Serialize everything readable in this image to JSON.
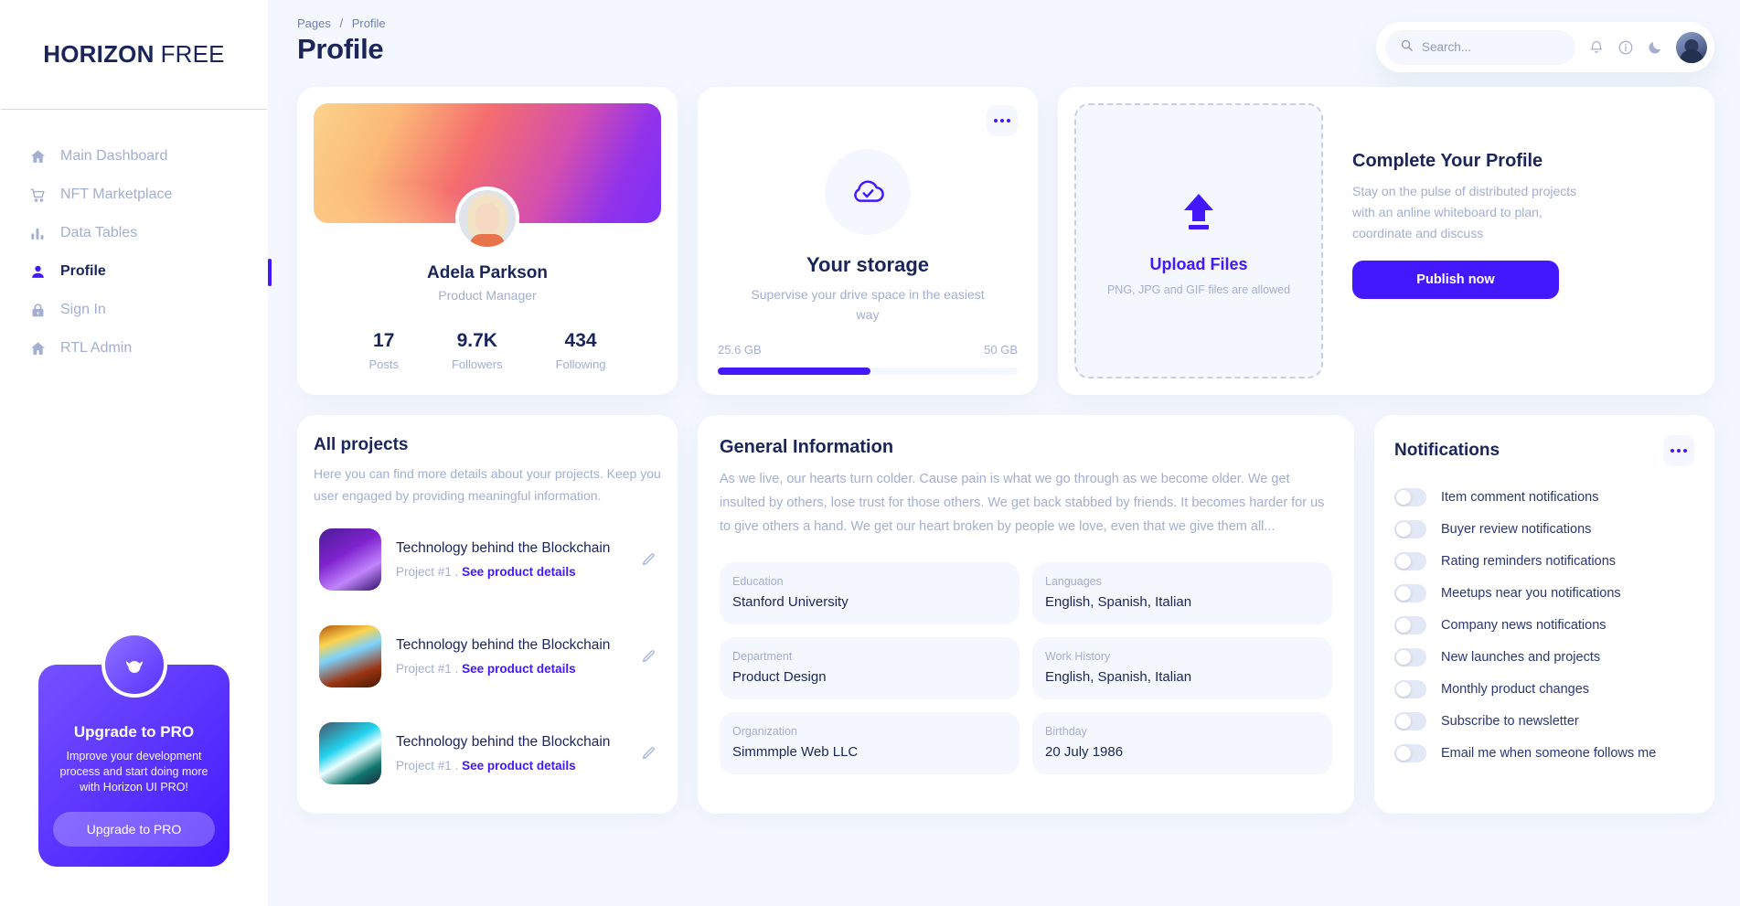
{
  "brand": {
    "bold": "HORIZON",
    "light": "FREE"
  },
  "sidebar": {
    "items": [
      {
        "label": "Main Dashboard",
        "icon": "home-icon",
        "active": false
      },
      {
        "label": "NFT Marketplace",
        "icon": "cart-icon",
        "active": false
      },
      {
        "label": "Data Tables",
        "icon": "bar-chart-icon",
        "active": false
      },
      {
        "label": "Profile",
        "icon": "person-icon",
        "active": true
      },
      {
        "label": "Sign In",
        "icon": "lock-icon",
        "active": false
      },
      {
        "label": "RTL Admin",
        "icon": "home-icon",
        "active": false
      }
    ],
    "pro": {
      "title": "Upgrade to PRO",
      "description": "Improve your development process and start doing more with Horizon UI PRO!",
      "button": "Upgrade to PRO"
    }
  },
  "header": {
    "breadcrumb_parent": "Pages",
    "breadcrumb_sep": "/",
    "breadcrumb_current": "Profile",
    "title": "Profile",
    "search_placeholder": "Search...",
    "search_value": ""
  },
  "profile_card": {
    "name": "Adela Parkson",
    "role": "Product Manager",
    "stats": [
      {
        "value": "17",
        "label": "Posts"
      },
      {
        "value": "9.7K",
        "label": "Followers"
      },
      {
        "value": "434",
        "label": "Following"
      }
    ]
  },
  "storage_card": {
    "title": "Your storage",
    "subtitle": "Supervise your drive space in the easiest way",
    "used": "25.6 GB",
    "total": "50 GB",
    "percent": 51
  },
  "upload_card": {
    "upload_link": "Upload Files",
    "hint": "PNG, JPG and GIF files are allowed",
    "title": "Complete Your Profile",
    "description": "Stay on the pulse of distributed projects with an anline whiteboard to plan, coordinate and discuss",
    "button": "Publish now"
  },
  "projects_card": {
    "title": "All projects",
    "description": "Here you can find more details about your projects. Keep you user engaged by providing meaningful information.",
    "items": [
      {
        "name": "Technology behind the Blockchain",
        "meta": "Project #1 .",
        "link": "See product details",
        "thumb": "blockchain-tunnel-thumb"
      },
      {
        "name": "Technology behind the Blockchain",
        "meta": "Project #1 .",
        "link": "See product details",
        "thumb": "canyon-thumb"
      },
      {
        "name": "Technology behind the Blockchain",
        "meta": "Project #1 .",
        "link": "See product details",
        "thumb": "coastline-thumb"
      }
    ]
  },
  "general_info": {
    "title": "General Information",
    "description": "As we live, our hearts turn colder. Cause pain is what we go through as we become older. We get insulted by others, lose trust for those others. We get back stabbed by friends. It becomes harder for us to give others a hand. We get our heart broken by people we love, even that we give them all...",
    "fields": [
      {
        "label": "Education",
        "value": "Stanford University"
      },
      {
        "label": "Languages",
        "value": "English, Spanish, Italian"
      },
      {
        "label": "Department",
        "value": "Product Design"
      },
      {
        "label": "Work History",
        "value": "English, Spanish, Italian"
      },
      {
        "label": "Organization",
        "value": "Simmmple Web LLC"
      },
      {
        "label": "Birthday",
        "value": "20 July 1986"
      }
    ]
  },
  "notifications_card": {
    "title": "Notifications",
    "items": [
      {
        "label": "Item comment notifications",
        "on": false
      },
      {
        "label": "Buyer review notifications",
        "on": false
      },
      {
        "label": "Rating reminders notifications",
        "on": false
      },
      {
        "label": "Meetups near you notifications",
        "on": false
      },
      {
        "label": "Company news notifications",
        "on": false
      },
      {
        "label": "New launches and projects",
        "on": false
      },
      {
        "label": "Monthly product changes",
        "on": false
      },
      {
        "label": "Subscribe to newsletter",
        "on": false
      },
      {
        "label": "Email me when someone follows me",
        "on": false
      }
    ]
  },
  "colors": {
    "accent": "#4318ff",
    "page_bg": "#f4f7fe",
    "text_dark": "#1b2559",
    "text_muted": "#a3aed0"
  }
}
